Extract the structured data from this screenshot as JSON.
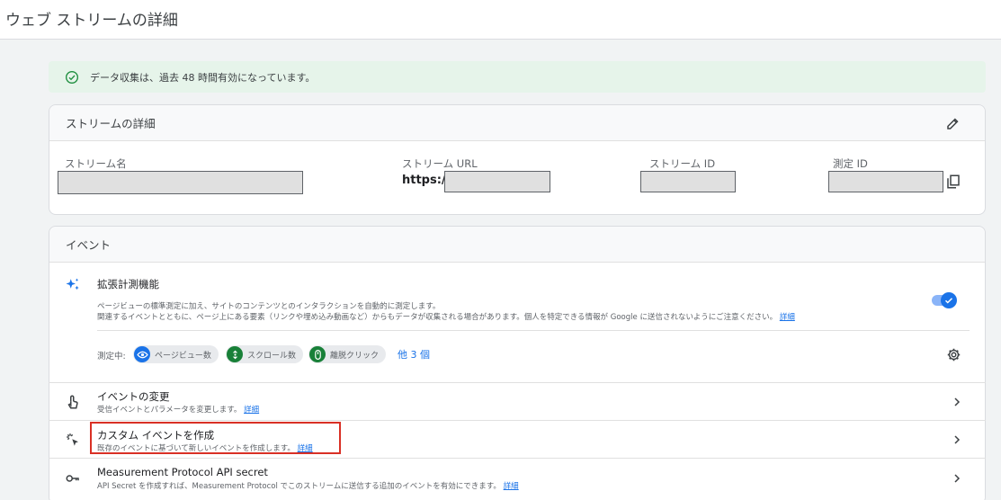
{
  "page": {
    "title": "ウェブ ストリームの詳細"
  },
  "banner": {
    "text": "データ収集は、過去 48 時間有効になっています。"
  },
  "stream_details": {
    "heading": "ストリームの詳細",
    "fields": {
      "name_label": "ストリーム名",
      "url_label": "ストリーム URL",
      "url_prefix": "https://",
      "id_label": "ストリーム ID",
      "measurement_id_label": "測定 ID"
    }
  },
  "events": {
    "heading": "イベント",
    "enhanced": {
      "title": "拡張計測機能",
      "desc_line1": "ページビューの標準測定に加え、サイトのコンテンツとのインタラクションを自動的に測定します。",
      "desc_line2": "関連するイベントとともに、ページ上にある要素（リンクや埋め込み動画など）からもデータが収集される場合があります。個人を特定できる情報が Google に送信されないようにご注意ください。",
      "detail_link": "詳細",
      "measuring_label": "測定中:",
      "chips": [
        "ページビュー数",
        "スクロール数",
        "離脱クリック"
      ],
      "more_link": "他 3 個",
      "toggle_on": true
    },
    "rows": [
      {
        "title": "イベントの変更",
        "desc": "受信イベントとパラメータを変更します。",
        "link": "詳細"
      },
      {
        "title": "カスタム イベントを作成",
        "desc": "既存のイベントに基づいて新しいイベントを作成します。",
        "link": "詳細"
      },
      {
        "title": "Measurement Protocol API secret",
        "desc": "API Secret を作成すれば、Measurement Protocol でこのストリームに送信する追加のイベントを有効にできます。",
        "link": "詳細"
      }
    ]
  },
  "colors": {
    "accent": "#1a73e8",
    "success": "#1e8e3e",
    "highlight": "#d93025"
  }
}
